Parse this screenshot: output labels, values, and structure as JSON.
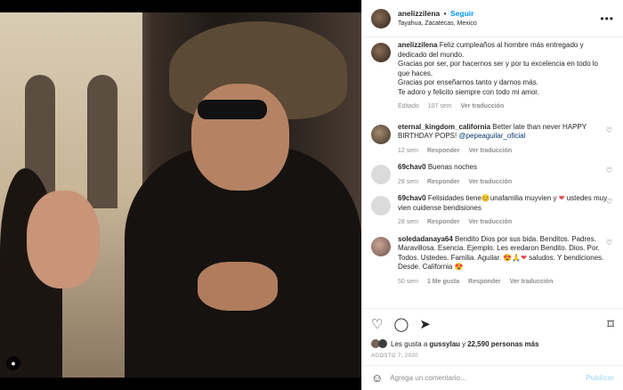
{
  "post": {
    "username": "anelizzilena",
    "follow_label": "Seguir",
    "location": "Tayahua, Zacatecas, Mexico",
    "more_icon": "more-icon"
  },
  "caption": {
    "username": "anelizzilena",
    "lines": [
      "Feliz cumpleaños al hombre más entregado y dedicado del mundo.",
      "Gracias por ser, por hacernos ser y por tu excelencia en todo lo que haces.",
      "Gracias por enseñarnos tanto y darnos más.",
      "Te adoro y felicito siempre con todo mi amor."
    ],
    "edited": "Editado",
    "time": "107 sem",
    "translate": "Ver traducción"
  },
  "comments": [
    {
      "username": "eternal_kingdom_california",
      "text": "Better late than never HAPPY BIRTHDAY POPS!",
      "mention": "@pepeaguilar_oficial",
      "time": "12 sem",
      "reply": "Responder",
      "translate": "Ver traducción"
    },
    {
      "username": "69chav0",
      "text": "Buenas noches",
      "time": "28 sem",
      "reply": "Responder",
      "translate": "Ver traducción"
    },
    {
      "username": "69chav0",
      "text_a": "Felisidades tiene",
      "text_b": "unafamilia muyvien y",
      "text_c": "ustedes muy vien cuidense bendisiones",
      "time": "28 sem",
      "reply": "Responder",
      "translate": "Ver traducción"
    },
    {
      "username": "soledadanaya64",
      "text_a": "Bendito Dios por sus bida. Benditos. Padres. Maravillosa. Esencia. Ejemplo. Les eredaron Bendito. Dios. Por. Todos. Ustedes. Familia. Aguilar.",
      "text_b": "saludos. Y bendiciones. Desde. California",
      "time": "50 sem",
      "likes": "1 Me gusta",
      "reply": "Responder",
      "translate": "Ver traducción"
    }
  ],
  "footer": {
    "likes_prefix": "Les gusta a",
    "likes_user": "gussylau",
    "likes_and": "y",
    "likes_count": "22,590 personas más",
    "date": "AGOSTO 7, 2020",
    "comment_placeholder": "Agrega un comentario...",
    "publish_label": "Publicar"
  },
  "colors": {
    "link": "#0095f6",
    "publish_disabled": "#b2dffc",
    "heart_red": "#ed4956"
  }
}
